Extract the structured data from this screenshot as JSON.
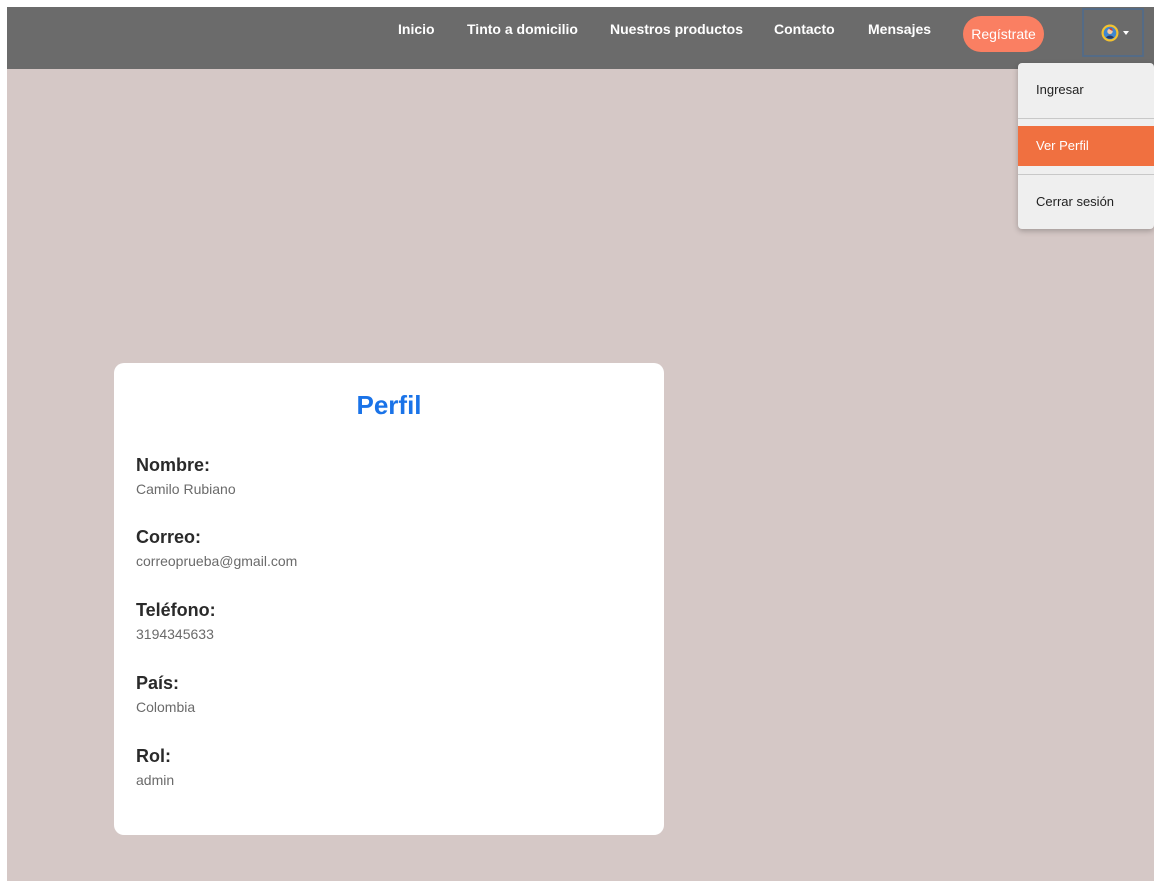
{
  "nav": {
    "links": [
      "Inicio",
      "Tinto a domicilio",
      "Nuestros productos",
      "Contacto",
      "Mensajes"
    ],
    "register_label": "Regístrate"
  },
  "user_menu": {
    "items": [
      "Ingresar",
      "Ver Perfil",
      "Cerrar sesión"
    ],
    "active_item": "Ver Perfil"
  },
  "profile": {
    "title": "Perfil",
    "fields": [
      {
        "label": "Nombre:",
        "value": "Camilo Rubiano"
      },
      {
        "label": "Correo:",
        "value": "correoprueba@gmail.com"
      },
      {
        "label": "Teléfono:",
        "value": "3194345633"
      },
      {
        "label": "País:",
        "value": "Colombia"
      },
      {
        "label": "Rol:",
        "value": "admin"
      }
    ]
  },
  "colors": {
    "navbar": "#6b6b6b",
    "page_background": "#d5c8c6",
    "register_button": "#fa7f62",
    "active_menu_item": "#f07040",
    "title": "#1a73e8"
  },
  "icons": {
    "user_avatar": "user-avatar-icon",
    "dropdown_caret": "caret-down-icon"
  }
}
